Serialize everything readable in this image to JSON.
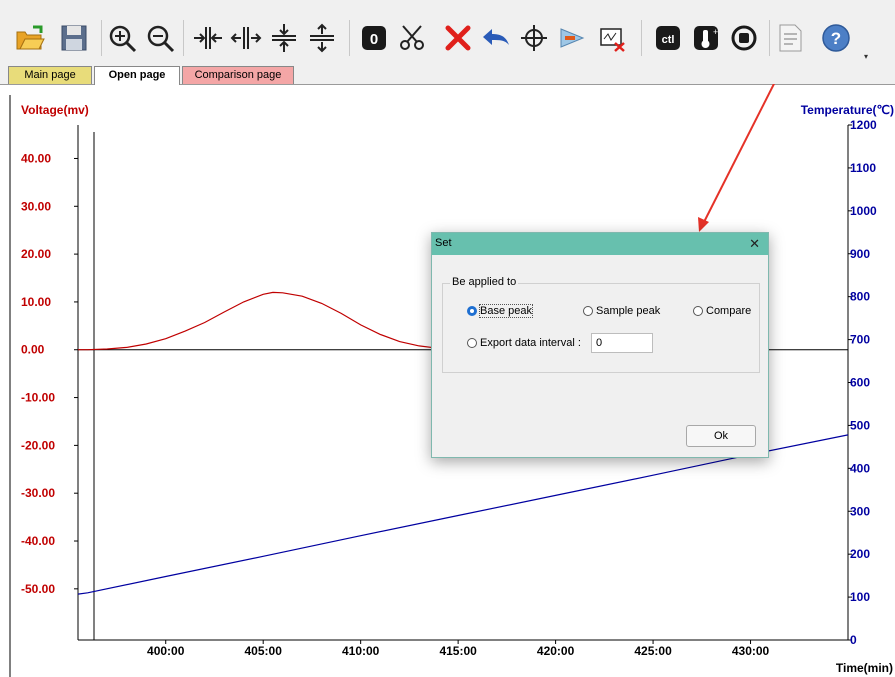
{
  "tabs": [
    {
      "label": "Main page",
      "color": "#e8dc7a"
    },
    {
      "label": "Open page",
      "color": "#ffffff"
    },
    {
      "label": "Comparison page",
      "color": "#f4a6a6"
    }
  ],
  "toolbar_icons": [
    "open-folder-icon",
    "save-icon",
    "zoom-in-icon",
    "zoom-out-icon",
    "horizontal-compress-icon",
    "horizontal-expand-icon",
    "vertical-compress-icon",
    "vertical-expand-icon",
    "zero-icon",
    "scissors-icon",
    "delete-icon",
    "undo-icon",
    "crosshair-icon",
    "marker-icon",
    "clear-chart-icon",
    "ct-icon",
    "temperature-icon",
    "stop-icon",
    "report-icon",
    "help-icon"
  ],
  "chart_data": {
    "type": "line",
    "y_left_label": "Voltage(mv)",
    "y_right_label": "Temperature(℃)",
    "x_label": "Time(min)",
    "y_left_ticks": [
      "40.00",
      "30.00",
      "20.00",
      "10.00",
      "0.00",
      "-10.00",
      "-20.00",
      "-30.00",
      "-40.00",
      "-50.00"
    ],
    "y_left_values": [
      40,
      30,
      20,
      10,
      0,
      -10,
      -20,
      -30,
      -40,
      -50
    ],
    "y_right_ticks": [
      "1200",
      "1100",
      "1000",
      "900",
      "800",
      "700",
      "600",
      "500",
      "400",
      "300",
      "200",
      "100",
      "0"
    ],
    "y_right_values": [
      1200,
      1100,
      1000,
      900,
      800,
      700,
      600,
      500,
      400,
      300,
      200,
      100,
      0
    ],
    "x_ticks": [
      "400:00",
      "405:00",
      "410:00",
      "415:00",
      "420:00",
      "425:00",
      "430:00"
    ],
    "x_values": [
      400,
      405,
      410,
      415,
      420,
      425,
      430
    ],
    "xlim": [
      395.5,
      435
    ],
    "ylim_left": [
      -60.7,
      47
    ],
    "ylim_right": [
      0,
      1200
    ],
    "series": [
      {
        "color": "#c00000",
        "axis": "left",
        "x": [
          395.5,
          396,
          397,
          398,
          399,
          400,
          401,
          402,
          403,
          404,
          405,
          405.5,
          406,
          407,
          408,
          409,
          410,
          411,
          412,
          413,
          414,
          415
        ],
        "y": [
          0,
          0,
          0.15,
          0.5,
          1.2,
          2.3,
          3.9,
          5.7,
          7.9,
          10,
          11.6,
          12,
          11.9,
          11.2,
          9.7,
          7.6,
          5.2,
          3.2,
          1.7,
          0.8,
          0.3,
          0
        ]
      },
      {
        "color": "#0000a0",
        "axis": "right",
        "x": [
          395.5,
          396,
          400,
          405,
          410,
          415,
          420,
          425,
          430,
          435
        ],
        "y": [
          107,
          110,
          148,
          195,
          243,
          290,
          337,
          384,
          432,
          478
        ]
      }
    ],
    "colors": {
      "left_axis": "#c00000",
      "right_axis": "#0000a0",
      "baseline": "#000000"
    }
  },
  "dialog": {
    "title": "Set",
    "close_glyph": "✕",
    "group_label": "Be applied to",
    "options": {
      "base_peak": "Base peak",
      "sample_peak": "Sample peak",
      "compare": "Compare",
      "export": "Export data interval :"
    },
    "selected": "Base peak",
    "export_value": "0",
    "ok_label": "Ok",
    "title_color": "#67c0ae"
  }
}
